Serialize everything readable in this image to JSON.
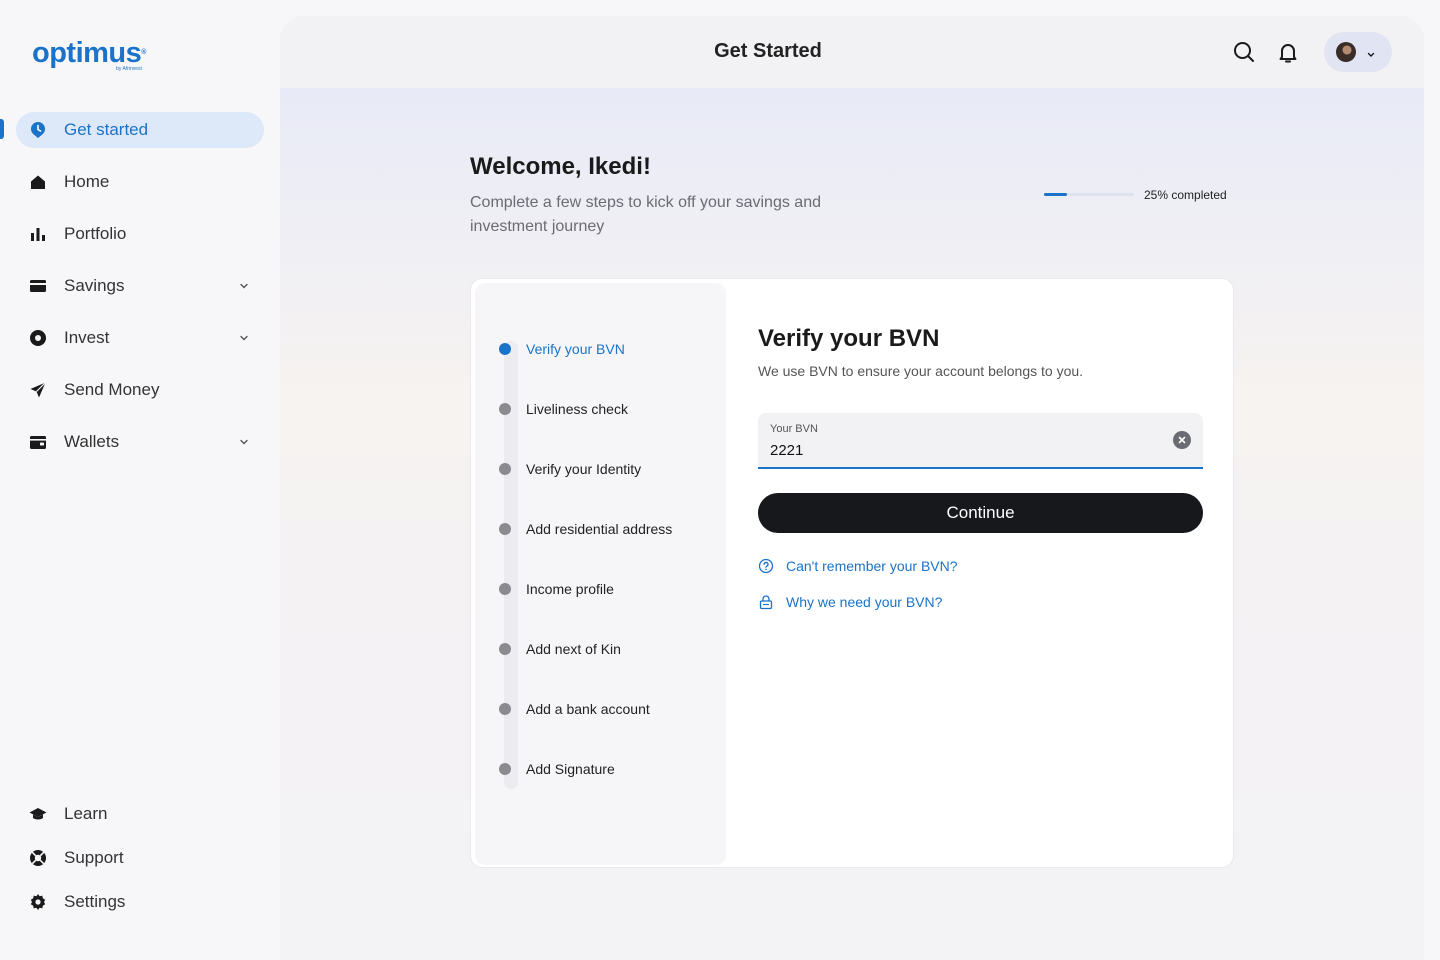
{
  "brand": {
    "name": "optimus",
    "tagline": "by Afrinvest",
    "color": "#1b73c9"
  },
  "sidebar": {
    "items": [
      {
        "label": "Get started",
        "icon": "clock-pin-icon",
        "active": true
      },
      {
        "label": "Home",
        "icon": "home-icon"
      },
      {
        "label": "Portfolio",
        "icon": "bar-chart-icon"
      },
      {
        "label": "Savings",
        "icon": "card-icon",
        "expandable": true
      },
      {
        "label": "Invest",
        "icon": "target-icon",
        "expandable": true
      },
      {
        "label": "Send Money",
        "icon": "send-icon"
      },
      {
        "label": "Wallets",
        "icon": "wallet-icon",
        "expandable": true
      }
    ],
    "bottom_items": [
      {
        "label": "Learn",
        "icon": "graduation-cap-icon"
      },
      {
        "label": "Support",
        "icon": "lifebuoy-icon"
      },
      {
        "label": "Settings",
        "icon": "gear-icon"
      }
    ]
  },
  "header": {
    "title": "Get Started"
  },
  "welcome": {
    "title": "Welcome, Ikedi!",
    "subtitle": "Complete a few steps to kick off your savings and investment journey",
    "progress_percent": 25,
    "progress_label": "25% completed"
  },
  "steps": [
    {
      "label": "Verify your BVN",
      "active": true
    },
    {
      "label": "Liveliness check"
    },
    {
      "label": "Verify your Identity"
    },
    {
      "label": "Add residential address"
    },
    {
      "label": "Income profile"
    },
    {
      "label": "Add next of Kin"
    },
    {
      "label": "Add a bank account"
    },
    {
      "label": "Add Signature"
    }
  ],
  "form": {
    "title": "Verify your BVN",
    "subtitle": "We use BVN to ensure your account belongs to you.",
    "field_label": "Your BVN",
    "field_value": "2221",
    "continue_label": "Continue",
    "help_links": [
      {
        "label": "Can't remember your BVN?",
        "icon": "question-circle-icon"
      },
      {
        "label": "Why we need your BVN?",
        "icon": "lock-icon"
      }
    ]
  }
}
